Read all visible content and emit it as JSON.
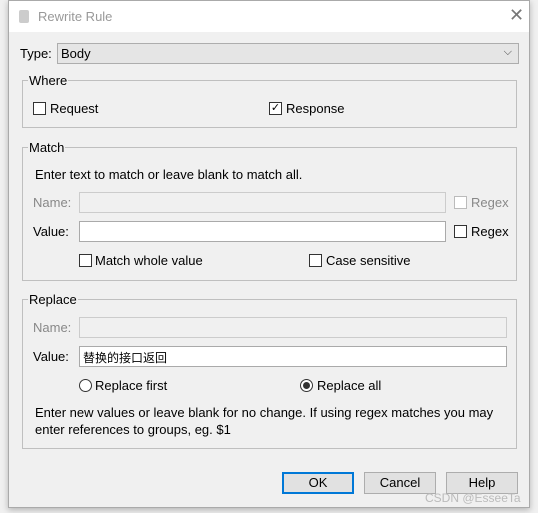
{
  "dialog": {
    "title": "Rewrite Rule",
    "app_icon": "rewrite-rule-icon",
    "close_icon": "close-icon"
  },
  "type": {
    "label": "Type:",
    "value": "Body"
  },
  "where": {
    "legend": "Where",
    "request": {
      "label": "Request",
      "checked": false
    },
    "response": {
      "label": "Response",
      "checked": true
    }
  },
  "match": {
    "legend": "Match",
    "hint": "Enter text to match or leave blank to match all.",
    "name_label": "Name:",
    "name_value": "",
    "name_regex": "Regex",
    "value_label": "Value:",
    "value_value": "",
    "value_regex": "Regex",
    "match_whole": "Match whole value",
    "case_sensitive": "Case sensitive"
  },
  "replace": {
    "legend": "Replace",
    "name_label": "Name:",
    "name_value": "",
    "value_label": "Value:",
    "value_value": "替换的接口返回",
    "replace_first": "Replace first",
    "replace_all": "Replace all",
    "selected": "Replace all",
    "hint1": "Enter new values or leave blank for no change. If using regex matches you may",
    "hint2": "enter references to groups, eg. $1"
  },
  "buttons": {
    "ok": "OK",
    "cancel": "Cancel",
    "help": "Help"
  },
  "watermark": "CSDN @EsseeTa"
}
